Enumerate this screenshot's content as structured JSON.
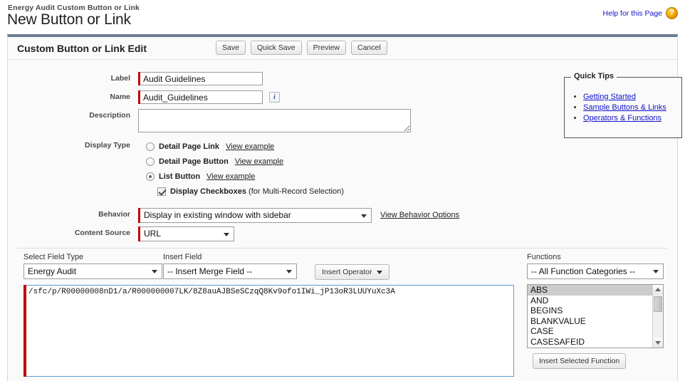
{
  "header": {
    "breadcrumb": "Energy Audit Custom Button or Link",
    "title": "New Button or Link",
    "help_link": "Help for this Page",
    "help_icon": "question-mark-icon"
  },
  "panel": {
    "section_title": "Custom Button or Link Edit",
    "buttons": [
      {
        "label": "Save",
        "name": "save-button"
      },
      {
        "label": "Quick Save",
        "name": "quick-save-button"
      },
      {
        "label": "Preview",
        "name": "preview-button"
      },
      {
        "label": "Cancel",
        "name": "cancel-button"
      }
    ]
  },
  "form": {
    "label_field": {
      "label": "Label",
      "value": "Audit Guidelines"
    },
    "name_field": {
      "label": "Name",
      "value": "Audit_Guidelines",
      "info_icon": "info-icon"
    },
    "description_field": {
      "label": "Description",
      "value": ""
    },
    "display_type": {
      "label": "Display Type",
      "options": [
        {
          "label": "Detail Page Link",
          "example": "View example",
          "selected": false
        },
        {
          "label": "Detail Page Button",
          "example": "View example",
          "selected": false
        },
        {
          "label": "List Button",
          "example": "View example",
          "selected": true
        }
      ],
      "checkbox": {
        "label_bold": "Display Checkboxes",
        "label_rest": " (for Multi-Record Selection)",
        "checked": true
      }
    },
    "behavior": {
      "label": "Behavior",
      "value": "Display in existing window with sidebar",
      "link": "View Behavior Options"
    },
    "content_source": {
      "label": "Content Source",
      "value": "URL"
    }
  },
  "quick_tips": {
    "legend": "Quick Tips",
    "links": [
      "Getting Started",
      "Sample Buttons & Links",
      "Operators & Functions"
    ]
  },
  "formula_editor": {
    "select_field_type_label": "Select Field Type",
    "select_field_type_value": "Energy Audit",
    "insert_field_label": "Insert Field",
    "insert_field_value": "-- Insert Merge Field --",
    "insert_operator_label": "Insert Operator",
    "formula_value": "/sfc/p/R00000008nD1/a/R000000007LK/8Z8auAJBSeSCzqQ8Kv9ofo1IWi_jP13oR3LUUYuXc3A",
    "functions_label": "Functions",
    "functions_category": "-- All Function Categories --",
    "functions": [
      {
        "name": "ABS",
        "selected": true
      },
      {
        "name": "AND",
        "selected": false
      },
      {
        "name": "BEGINS",
        "selected": false
      },
      {
        "name": "BLANKVALUE",
        "selected": false
      },
      {
        "name": "CASE",
        "selected": false
      },
      {
        "name": "CASESAFEID",
        "selected": false
      }
    ],
    "insert_function_label": "Insert Selected Function"
  },
  "colors": {
    "required_marker": "#c00000",
    "panel_top_border": "#6b7c93",
    "link": "#1111cc",
    "focus_border": "#5b9dd9"
  }
}
